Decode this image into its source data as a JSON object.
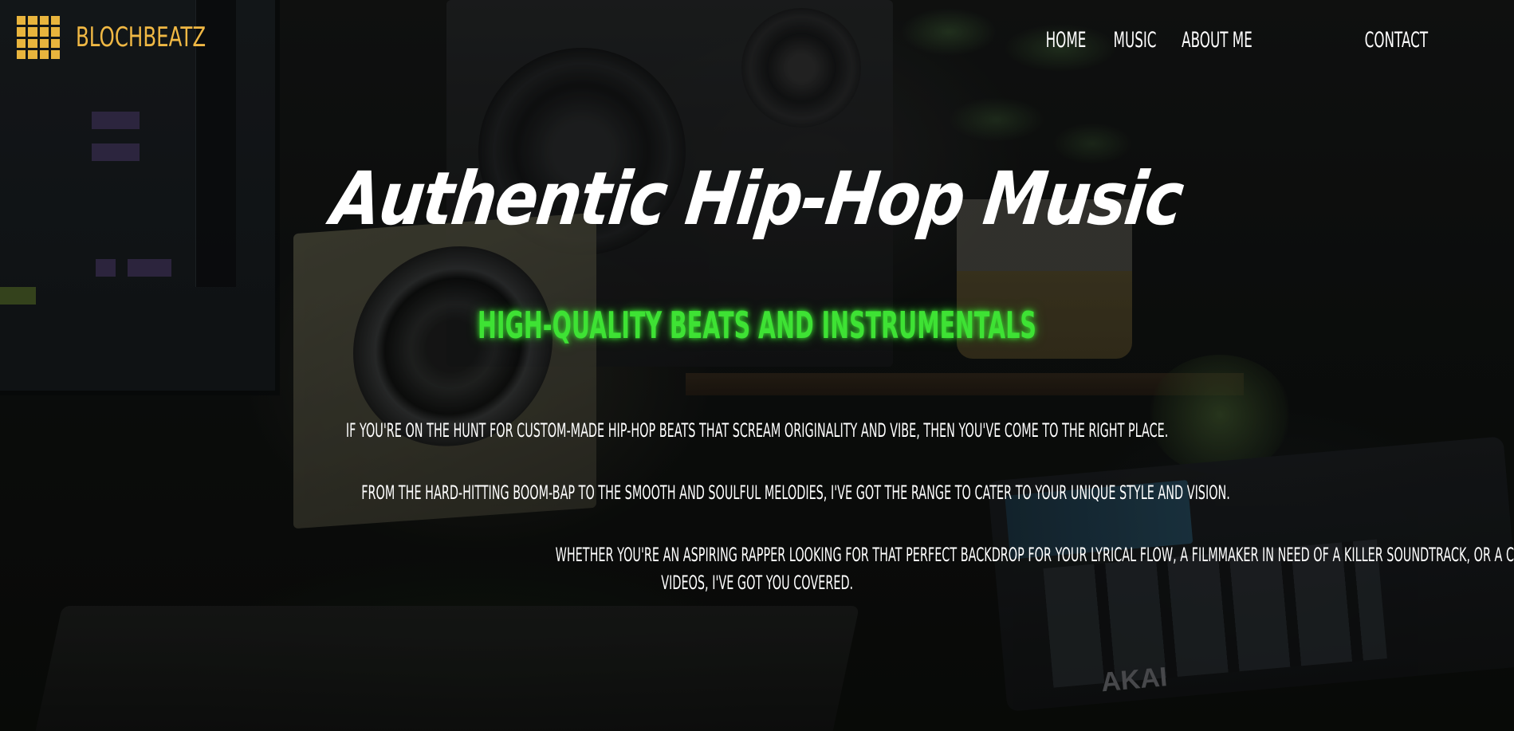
{
  "brand": {
    "logo_icon": "drum-pad-grid-icon",
    "name": "BLOCHBEATZ",
    "color": "#f0b844"
  },
  "nav": {
    "items": [
      {
        "label": "HOME"
      },
      {
        "label": "MUSIC"
      },
      {
        "label": "ABOUT ME"
      },
      {
        "label": "CONTACT"
      }
    ]
  },
  "hero": {
    "title": "Authentic Hip-Hop Music",
    "subtitle": "HIGH-QUALITY BEATS AND INSTRUMENTALS",
    "subtitle_color": "#3ee234",
    "paragraphs": [
      "IF YOU'RE ON THE HUNT FOR CUSTOM-MADE HIP-HOP BEATS THAT SCREAM ORIGINALITY AND VIBE, THEN YOU'VE COME TO THE RIGHT PLACE.",
      "FROM THE HARD-HITTING BOOM-BAP TO THE SMOOTH AND SOULFUL MELODIES, I'VE GOT THE RANGE TO CATER TO YOUR UNIQUE STYLE AND VISION.",
      "WHETHER YOU'RE AN ASPIRING RAPPER LOOKING FOR THAT PERFECT BACKDROP FOR YOUR LYRICAL FLOW, A FILMMAKER IN NEED OF A KILLER SOUNDTRACK, OR A CONTENT CREATOR SEARCHING FOR THE PERFECT BEAT TO SET THE MOOD FOR YOUR",
      "VIDEOS, I'VE GOT YOU COVERED."
    ]
  },
  "background": {
    "description_icon": "studio-background-image"
  }
}
